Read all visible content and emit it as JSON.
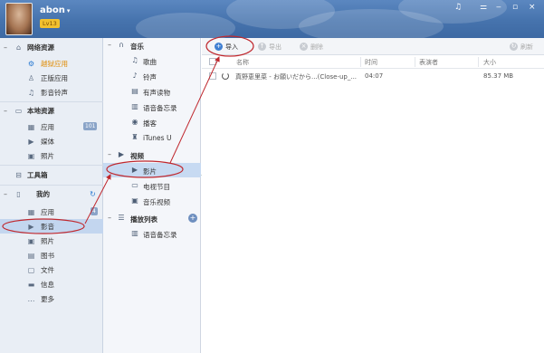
{
  "app": {
    "user_name": "abon",
    "user_caret": "▾",
    "badge": "Lv13",
    "window_controls": [
      "♫",
      "⚌",
      "‒",
      "▫",
      "×"
    ]
  },
  "nav": {
    "sections": [
      {
        "label": "网络资源",
        "items": [
          {
            "label": "越狱应用",
            "icon": "jailbreak-app-icon"
          },
          {
            "label": "正版应用",
            "icon": "app-store-icon"
          },
          {
            "label": "影音铃声",
            "icon": "music-note-icon"
          }
        ]
      },
      {
        "label": "本地资源",
        "items": [
          {
            "label": "应用",
            "icon": "apps-grid-icon",
            "count": "101"
          },
          {
            "label": "媒体",
            "icon": "video-camera-icon"
          },
          {
            "label": "照片",
            "icon": "photo-icon"
          }
        ]
      },
      {
        "label": "工具箱"
      },
      {
        "label": "我的",
        "items": [
          {
            "label": "应用",
            "icon": "apps-grid-icon",
            "count": "4"
          },
          {
            "label": "影音",
            "icon": "video-camera-icon"
          },
          {
            "label": "照片",
            "icon": "photo-icon"
          },
          {
            "label": "图书",
            "icon": "book-icon"
          },
          {
            "label": "文件",
            "icon": "file-icon"
          },
          {
            "label": "信息",
            "icon": "message-icon"
          },
          {
            "label": "更多",
            "icon": "more-icon"
          }
        ]
      }
    ]
  },
  "categories": {
    "music": {
      "label": "音乐",
      "items": [
        "歌曲",
        "铃声",
        "有声读物",
        "语音备忘录",
        "播客",
        "iTunes U"
      ]
    },
    "video": {
      "label": "视频",
      "items": [
        "影片",
        "电视节目",
        "音乐视频"
      ]
    },
    "playlist": {
      "label": "播放列表",
      "items": [
        "语音备忘录"
      ]
    }
  },
  "toolbar": {
    "import": "导入",
    "export": "导出",
    "delete": "删除",
    "refresh": "刷新"
  },
  "table": {
    "columns": [
      "名称",
      "时间",
      "表演者",
      "大小"
    ],
    "rows": [
      {
        "name": "真野恵里菜 - お願いだから...(Close-up_...",
        "time": "04:07",
        "artist": "",
        "size": "85.37 MB"
      }
    ]
  },
  "colors": {
    "titlebar": "#4a77b1",
    "nav_bg": "#e9eef5",
    "accent": "#3f7fd1",
    "annotation": "#c0282e",
    "active_text": "#e08a00"
  }
}
